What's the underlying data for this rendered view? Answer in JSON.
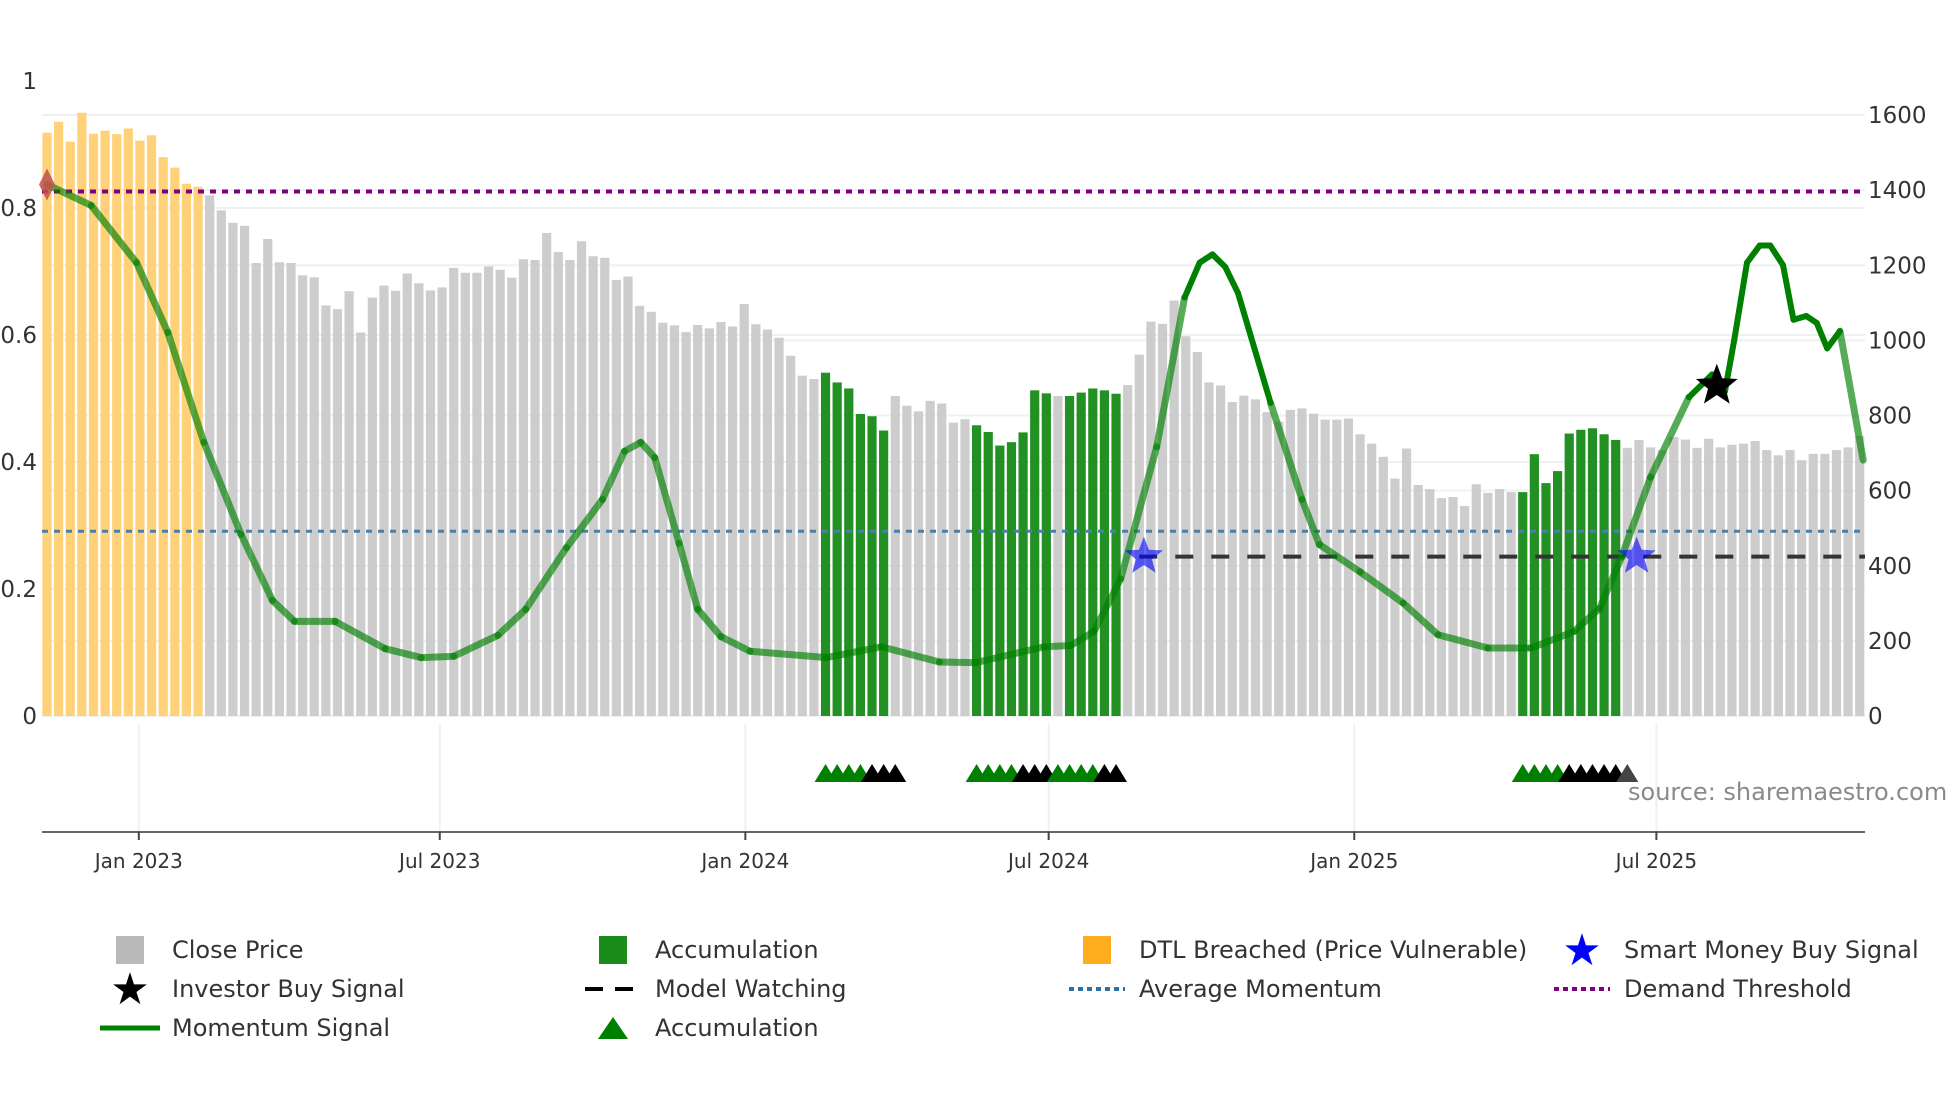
{
  "chart_data": {
    "type": "bar",
    "title": "",
    "source": "source: sharemaestro.com",
    "left_axis": {
      "ticks": [
        0,
        0.2,
        0.4,
        0.6,
        0.8,
        1
      ],
      "labels": [
        "0",
        "0.2",
        "0.4",
        "0.6",
        "0.8",
        "1"
      ],
      "range": [
        0,
        1
      ]
    },
    "right_axis": {
      "ticks": [
        0,
        200,
        400,
        600,
        800,
        1000,
        1200,
        1400,
        1600
      ],
      "labels": [
        "0",
        "200",
        "400",
        "600",
        "800",
        "1000",
        "1200",
        "1400",
        "1600"
      ],
      "range": [
        0,
        1600
      ]
    },
    "x_ticks": [
      {
        "index": 7.9,
        "label": "Jan 2023"
      },
      {
        "index": 33.8,
        "label": "Jul 2023"
      },
      {
        "index": 60.1,
        "label": "Jan 2024"
      },
      {
        "index": 86.2,
        "label": "Jul 2024"
      },
      {
        "index": 112.5,
        "label": "Jan 2025"
      },
      {
        "index": 138.5,
        "label": "Jul 2025"
      }
    ],
    "close_price": [
      1553,
      1582,
      1529,
      1606,
      1550,
      1558,
      1549,
      1564,
      1532,
      1546,
      1488,
      1460,
      1417,
      1409,
      1386,
      1346,
      1313,
      1305,
      1206,
      1270,
      1208,
      1206,
      1173,
      1168,
      1093,
      1083,
      1131,
      1021,
      1114,
      1146,
      1132,
      1178,
      1152,
      1133,
      1141,
      1193,
      1180,
      1180,
      1197,
      1188,
      1167,
      1216,
      1214,
      1286,
      1235,
      1214,
      1264,
      1224,
      1220,
      1161,
      1170,
      1092,
      1076,
      1047,
      1040,
      1022,
      1041,
      1032,
      1049,
      1037,
      1097,
      1043,
      1029,
      1007,
      959,
      906,
      897,
      914,
      888,
      872,
      804,
      798,
      760,
      852,
      826,
      811,
      839,
      832,
      781,
      790,
      774,
      756,
      720,
      729,
      755,
      867,
      859,
      852,
      852,
      861,
      872,
      867,
      858,
      881,
      962,
      1050,
      1044,
      1106,
      1011,
      969,
      888,
      880,
      836,
      853,
      843,
      809,
      784,
      815,
      819,
      805,
      789,
      789,
      792,
      750,
      725,
      690,
      632,
      712,
      615,
      604,
      580,
      583,
      559,
      617,
      594,
      604,
      596,
      596,
      697,
      620,
      652,
      752,
      762,
      766,
      750,
      735,
      714,
      735,
      715,
      708,
      743,
      736,
      714,
      738,
      715,
      722,
      725,
      732,
      708,
      694,
      708,
      681,
      698,
      698,
      708,
      715,
      746
    ],
    "bar_state_ranges": [
      {
        "state": "dtl_breached",
        "from": 0,
        "to": 13
      },
      {
        "state": "accumulation",
        "from": 67,
        "to": 72
      },
      {
        "state": "accumulation",
        "from": 80,
        "to": 86
      },
      {
        "state": "accumulation",
        "from": 88,
        "to": 92
      },
      {
        "state": "accumulation",
        "from": 127,
        "to": 135
      }
    ],
    "momentum_signal": [
      [
        0,
        0.837
      ],
      [
        3.8,
        0.804
      ],
      [
        7.7,
        0.714
      ],
      [
        10.4,
        0.604
      ],
      [
        13.5,
        0.431
      ],
      [
        16.7,
        0.286
      ],
      [
        19.4,
        0.182
      ],
      [
        21.3,
        0.149
      ],
      [
        24.8,
        0.149
      ],
      [
        29.1,
        0.106
      ],
      [
        32.2,
        0.092
      ],
      [
        35,
        0.094
      ],
      [
        38.8,
        0.127
      ],
      [
        41.2,
        0.168
      ],
      [
        44.7,
        0.265
      ],
      [
        47.8,
        0.341
      ],
      [
        49.7,
        0.417
      ],
      [
        51.1,
        0.431
      ],
      [
        52.3,
        0.407
      ],
      [
        54.4,
        0.272
      ],
      [
        56,
        0.168
      ],
      [
        58,
        0.125
      ],
      [
        60.5,
        0.102
      ],
      [
        67.1,
        0.092
      ],
      [
        71.8,
        0.109
      ],
      [
        76.8,
        0.085
      ],
      [
        79.9,
        0.084
      ],
      [
        85.8,
        0.109
      ],
      [
        88.1,
        0.111
      ],
      [
        90.1,
        0.133
      ],
      [
        92.4,
        0.216
      ],
      [
        95.5,
        0.424
      ],
      [
        97.9,
        0.659
      ],
      [
        99.2,
        0.714
      ],
      [
        100.3,
        0.727
      ],
      [
        101.4,
        0.707
      ],
      [
        102.5,
        0.666
      ],
      [
        105.3,
        0.493
      ],
      [
        108,
        0.341
      ],
      [
        109.5,
        0.27
      ],
      [
        113,
        0.227
      ],
      [
        116.7,
        0.178
      ],
      [
        119.7,
        0.128
      ],
      [
        124,
        0.107
      ],
      [
        127.7,
        0.107
      ],
      [
        131.4,
        0.133
      ],
      [
        133.6,
        0.169
      ],
      [
        135.5,
        0.25
      ],
      [
        138,
        0.376
      ],
      [
        141.3,
        0.502
      ],
      [
        143.3,
        0.538
      ],
      [
        144.4,
        0.511
      ],
      [
        145.2,
        0.592
      ],
      [
        146.3,
        0.714
      ],
      [
        147.4,
        0.741
      ],
      [
        148.3,
        0.741
      ],
      [
        149.4,
        0.71
      ],
      [
        150.3,
        0.624
      ],
      [
        151.4,
        0.63
      ],
      [
        152.3,
        0.619
      ],
      [
        153.2,
        0.579
      ],
      [
        154.3,
        0.606
      ],
      [
        156.3,
        0.403
      ]
    ],
    "average_momentum": 0.291,
    "demand_threshold": 0.826,
    "model_watching": {
      "value": 0.251,
      "from": 94,
      "to": 156
    },
    "dtl_marker": {
      "index": 0,
      "value": 0.837
    },
    "smart_money_buy_signals": [
      {
        "index": 94.4,
        "value": 0.251
      },
      {
        "index": 136.8,
        "value": 0.251
      }
    ],
    "investor_buy_signals": [
      {
        "index": 143.7,
        "value": 0.52
      }
    ],
    "accumulation_triangles": [
      {
        "index": 67,
        "color": "green"
      },
      {
        "index": 68,
        "color": "green"
      },
      {
        "index": 69,
        "color": "green"
      },
      {
        "index": 70,
        "color": "green"
      },
      {
        "index": 71,
        "color": "black"
      },
      {
        "index": 72,
        "color": "black"
      },
      {
        "index": 73,
        "color": "black"
      },
      {
        "index": 80,
        "color": "green"
      },
      {
        "index": 81,
        "color": "green"
      },
      {
        "index": 82,
        "color": "green"
      },
      {
        "index": 83,
        "color": "green"
      },
      {
        "index": 84,
        "color": "black"
      },
      {
        "index": 85,
        "color": "black"
      },
      {
        "index": 86,
        "color": "black"
      },
      {
        "index": 87,
        "color": "green"
      },
      {
        "index": 88,
        "color": "green"
      },
      {
        "index": 89,
        "color": "green"
      },
      {
        "index": 90,
        "color": "green"
      },
      {
        "index": 91,
        "color": "black"
      },
      {
        "index": 92,
        "color": "black"
      },
      {
        "index": 127,
        "color": "green"
      },
      {
        "index": 128,
        "color": "green"
      },
      {
        "index": 129,
        "color": "green"
      },
      {
        "index": 130,
        "color": "green"
      },
      {
        "index": 131,
        "color": "black"
      },
      {
        "index": 132,
        "color": "black"
      },
      {
        "index": 133,
        "color": "black"
      },
      {
        "index": 134,
        "color": "black"
      },
      {
        "index": 135,
        "color": "black"
      },
      {
        "index": 136,
        "color": "gray"
      }
    ],
    "colors": {
      "close": "#c8c8c8",
      "accumulation": "#239023",
      "dtl": "#ffd27a",
      "momentum": "#008000",
      "average": "#4a7fa8",
      "threshold": "#800080",
      "model_watching": "#333333",
      "smart_money": "#0000ff",
      "investor": "#000000",
      "dtl_marker": "#c0504d"
    },
    "legend": [
      {
        "label": "Close Price",
        "icon": "gray-square"
      },
      {
        "label": "Accumulation",
        "icon": "green-square"
      },
      {
        "label": "DTL Breached (Price Vulnerable)",
        "icon": "orange-square"
      },
      {
        "label": "Smart Money Buy Signal",
        "icon": "blue-star"
      },
      {
        "label": "Investor Buy Signal",
        "icon": "black-star"
      },
      {
        "label": "Model Watching",
        "icon": "black-dash"
      },
      {
        "label": "Average Momentum",
        "icon": "blue-dot-line"
      },
      {
        "label": "Demand Threshold",
        "icon": "purple-dot-line"
      },
      {
        "label": "Momentum Signal",
        "icon": "green-line"
      },
      {
        "label": "Accumulation",
        "icon": "green-triangle"
      }
    ]
  }
}
